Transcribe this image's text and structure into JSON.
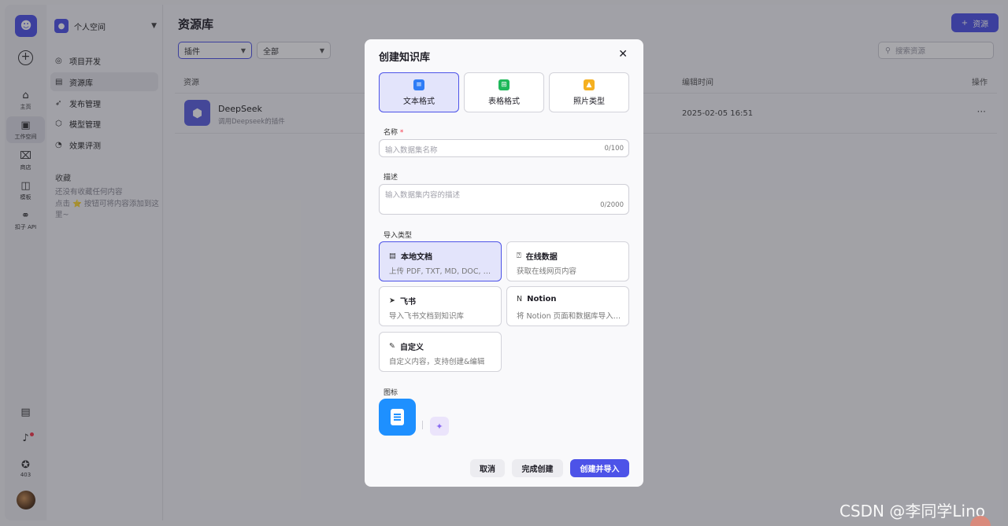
{
  "rail": {
    "items": [
      {
        "label": "主页",
        "icon": "home-icon",
        "glyph": "⌂"
      },
      {
        "label": "工作空间",
        "icon": "terminal-icon",
        "glyph": "▣"
      },
      {
        "label": "商店",
        "icon": "store-icon",
        "glyph": "⌧"
      },
      {
        "label": "模板",
        "icon": "template-icon",
        "glyph": "◫"
      },
      {
        "label": "扣子 API",
        "icon": "api-icon",
        "glyph": "⚭"
      }
    ],
    "badge_count": "403"
  },
  "sidebar": {
    "space_name": "个人空间",
    "nav": [
      {
        "label": "项目开发",
        "glyph": "◎"
      },
      {
        "label": "资源库",
        "glyph": "▤"
      },
      {
        "label": "发布管理",
        "glyph": "➶"
      },
      {
        "label": "模型管理",
        "glyph": "⬡"
      },
      {
        "label": "效果评测",
        "glyph": "◔"
      }
    ],
    "favorites_title": "收藏",
    "favorites_empty": "还没有收藏任何内容",
    "favorites_hint": "点击 ⭐ 按钮可将内容添加到这里~"
  },
  "main": {
    "title": "资源库",
    "add_button": "资源",
    "filter_type": "插件",
    "filter_scope": "全部",
    "search_placeholder": "搜索资源",
    "columns": {
      "resource": "资源",
      "edit_time": "编辑时间",
      "action": "操作"
    },
    "row": {
      "name": "DeepSeek",
      "desc": "调用Deepseek的插件",
      "time": "2025-02-05 16:51",
      "more": "···"
    }
  },
  "modal": {
    "title": "创建知识库",
    "formats": [
      {
        "label": "文本格式",
        "color": "#2f7cf6",
        "glyph": "≡"
      },
      {
        "label": "表格格式",
        "color": "#1fb85a",
        "glyph": "⊞"
      },
      {
        "label": "照片类型",
        "color": "#f5b020",
        "glyph": "▲"
      }
    ],
    "name_label": "名称",
    "name_placeholder": "输入数据集名称",
    "name_count": "0/100",
    "desc_label": "描述",
    "desc_placeholder": "输入数据集内容的描述",
    "desc_count": "0/2000",
    "import_label": "导入类型",
    "import_types": [
      {
        "title": "本地文档",
        "desc": "上传 PDF, TXT, MD, DOC, DOCX 格式的本地文件",
        "glyph": "▤"
      },
      {
        "title": "在线数据",
        "desc": "获取在线网页内容",
        "glyph": "⍰"
      },
      {
        "title": "飞书",
        "desc": "导入飞书文档到知识库",
        "glyph": "➤"
      },
      {
        "title": "Notion",
        "desc": "将 Notion 页面和数据库导入到知识库",
        "glyph": "N"
      },
      {
        "title": "自定义",
        "desc": "自定义内容，支持创建&编辑",
        "glyph": "✎"
      }
    ],
    "icon_label": "图标",
    "cancel": "取消",
    "finish": "完成创建",
    "create_import": "创建并导入"
  },
  "watermark": "CSDN @李同学Lino"
}
